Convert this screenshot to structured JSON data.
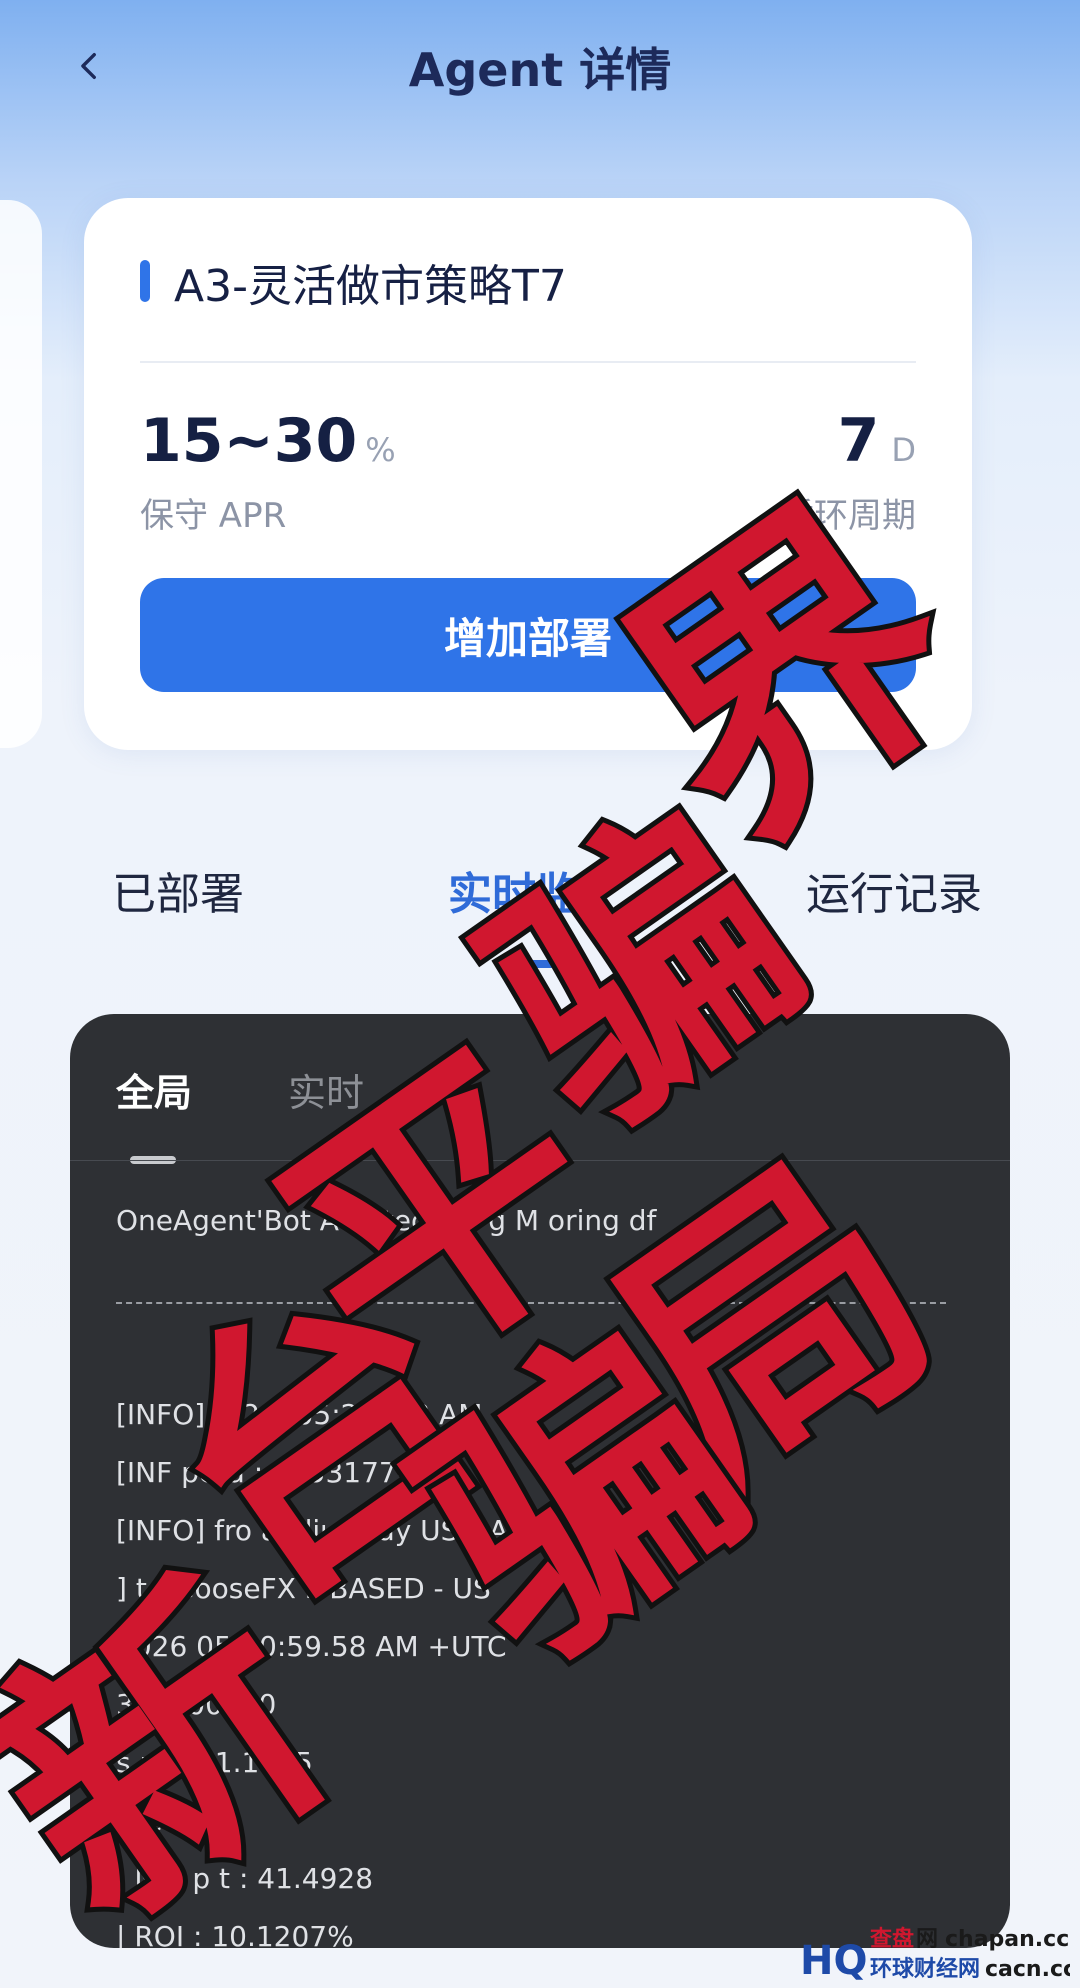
{
  "header": {
    "title": "Agent 详情"
  },
  "agent_card": {
    "name": "A3-灵活做市策略T7",
    "apr_value": "15~30",
    "apr_unit": "%",
    "apr_label": "保守 APR",
    "cycle_value": "7",
    "cycle_unit": "D",
    "cycle_label": "循环周期",
    "deploy_button": "增加部署"
  },
  "tabs": [
    {
      "label": "已部署"
    },
    {
      "label": "实时监"
    },
    {
      "label": "运行记录"
    }
  ],
  "panel": {
    "sub_tabs": [
      {
        "label": "全局"
      },
      {
        "label": "实时"
      }
    ],
    "log_lines": [
      "OneAgent'Bot Au    ated Tra   g M    oring    df",
      "[INFO] A     2   5 05:20:5   3 AM +   C",
      "[INF   pera       : 1953177-32",
      "[INFO] fro   aydiu   (Buy USD    A   D(",
      "    ] to GooseFX      ll BASED - US",
      "                  2026 05:20:59.58 AM +UTC",
      "                          304500000",
      "    s     rit : 51.1695",
      "| re     0083",
      "| Net p   t : 41.4928",
      "| ROI : 10.1207%"
    ]
  },
  "watermark": {
    "chars": [
      "界",
      "骗",
      "局",
      "平",
      "台",
      "新",
      "骗"
    ],
    "color": "#d0172f"
  },
  "corner_logo": {
    "badge": "HQ",
    "line1_a": "查盘",
    "line1_b": "网",
    "line1_c": "chapan.cc",
    "line2_a": "环球财经网",
    "line2_b": "cacn.cc"
  }
}
